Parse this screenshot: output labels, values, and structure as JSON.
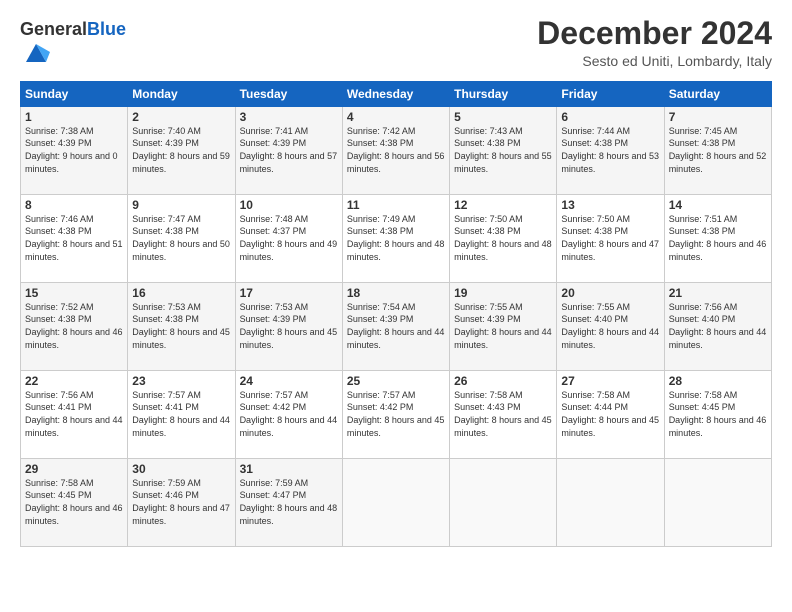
{
  "logo": {
    "general": "General",
    "blue": "Blue"
  },
  "header": {
    "month": "December 2024",
    "location": "Sesto ed Uniti, Lombardy, Italy"
  },
  "days_of_week": [
    "Sunday",
    "Monday",
    "Tuesday",
    "Wednesday",
    "Thursday",
    "Friday",
    "Saturday"
  ],
  "weeks": [
    [
      {
        "day": 1,
        "sunrise": "7:38 AM",
        "sunset": "4:39 PM",
        "daylight": "9 hours and 0 minutes"
      },
      {
        "day": 2,
        "sunrise": "7:40 AM",
        "sunset": "4:39 PM",
        "daylight": "8 hours and 59 minutes"
      },
      {
        "day": 3,
        "sunrise": "7:41 AM",
        "sunset": "4:39 PM",
        "daylight": "8 hours and 57 minutes"
      },
      {
        "day": 4,
        "sunrise": "7:42 AM",
        "sunset": "4:38 PM",
        "daylight": "8 hours and 56 minutes"
      },
      {
        "day": 5,
        "sunrise": "7:43 AM",
        "sunset": "4:38 PM",
        "daylight": "8 hours and 55 minutes"
      },
      {
        "day": 6,
        "sunrise": "7:44 AM",
        "sunset": "4:38 PM",
        "daylight": "8 hours and 53 minutes"
      },
      {
        "day": 7,
        "sunrise": "7:45 AM",
        "sunset": "4:38 PM",
        "daylight": "8 hours and 52 minutes"
      }
    ],
    [
      {
        "day": 8,
        "sunrise": "7:46 AM",
        "sunset": "4:38 PM",
        "daylight": "8 hours and 51 minutes"
      },
      {
        "day": 9,
        "sunrise": "7:47 AM",
        "sunset": "4:38 PM",
        "daylight": "8 hours and 50 minutes"
      },
      {
        "day": 10,
        "sunrise": "7:48 AM",
        "sunset": "4:37 PM",
        "daylight": "8 hours and 49 minutes"
      },
      {
        "day": 11,
        "sunrise": "7:49 AM",
        "sunset": "4:38 PM",
        "daylight": "8 hours and 48 minutes"
      },
      {
        "day": 12,
        "sunrise": "7:50 AM",
        "sunset": "4:38 PM",
        "daylight": "8 hours and 48 minutes"
      },
      {
        "day": 13,
        "sunrise": "7:50 AM",
        "sunset": "4:38 PM",
        "daylight": "8 hours and 47 minutes"
      },
      {
        "day": 14,
        "sunrise": "7:51 AM",
        "sunset": "4:38 PM",
        "daylight": "8 hours and 46 minutes"
      }
    ],
    [
      {
        "day": 15,
        "sunrise": "7:52 AM",
        "sunset": "4:38 PM",
        "daylight": "8 hours and 46 minutes"
      },
      {
        "day": 16,
        "sunrise": "7:53 AM",
        "sunset": "4:38 PM",
        "daylight": "8 hours and 45 minutes"
      },
      {
        "day": 17,
        "sunrise": "7:53 AM",
        "sunset": "4:39 PM",
        "daylight": "8 hours and 45 minutes"
      },
      {
        "day": 18,
        "sunrise": "7:54 AM",
        "sunset": "4:39 PM",
        "daylight": "8 hours and 44 minutes"
      },
      {
        "day": 19,
        "sunrise": "7:55 AM",
        "sunset": "4:39 PM",
        "daylight": "8 hours and 44 minutes"
      },
      {
        "day": 20,
        "sunrise": "7:55 AM",
        "sunset": "4:40 PM",
        "daylight": "8 hours and 44 minutes"
      },
      {
        "day": 21,
        "sunrise": "7:56 AM",
        "sunset": "4:40 PM",
        "daylight": "8 hours and 44 minutes"
      }
    ],
    [
      {
        "day": 22,
        "sunrise": "7:56 AM",
        "sunset": "4:41 PM",
        "daylight": "8 hours and 44 minutes"
      },
      {
        "day": 23,
        "sunrise": "7:57 AM",
        "sunset": "4:41 PM",
        "daylight": "8 hours and 44 minutes"
      },
      {
        "day": 24,
        "sunrise": "7:57 AM",
        "sunset": "4:42 PM",
        "daylight": "8 hours and 44 minutes"
      },
      {
        "day": 25,
        "sunrise": "7:57 AM",
        "sunset": "4:42 PM",
        "daylight": "8 hours and 45 minutes"
      },
      {
        "day": 26,
        "sunrise": "7:58 AM",
        "sunset": "4:43 PM",
        "daylight": "8 hours and 45 minutes"
      },
      {
        "day": 27,
        "sunrise": "7:58 AM",
        "sunset": "4:44 PM",
        "daylight": "8 hours and 45 minutes"
      },
      {
        "day": 28,
        "sunrise": "7:58 AM",
        "sunset": "4:45 PM",
        "daylight": "8 hours and 46 minutes"
      }
    ],
    [
      {
        "day": 29,
        "sunrise": "7:58 AM",
        "sunset": "4:45 PM",
        "daylight": "8 hours and 46 minutes"
      },
      {
        "day": 30,
        "sunrise": "7:59 AM",
        "sunset": "4:46 PM",
        "daylight": "8 hours and 47 minutes"
      },
      {
        "day": 31,
        "sunrise": "7:59 AM",
        "sunset": "4:47 PM",
        "daylight": "8 hours and 48 minutes"
      },
      null,
      null,
      null,
      null
    ]
  ]
}
